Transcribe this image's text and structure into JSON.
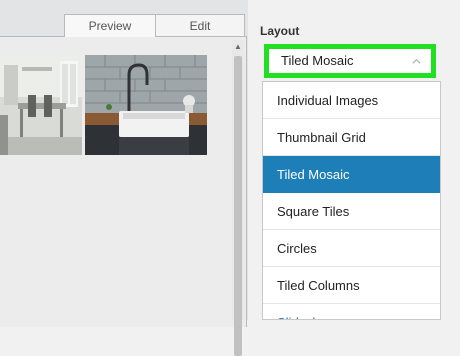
{
  "editor": {
    "tabs": [
      {
        "label": "Preview",
        "active": true
      },
      {
        "label": "Edit",
        "active": false
      }
    ]
  },
  "layout_panel": {
    "heading": "Layout",
    "select": {
      "value": "Tiled Mosaic",
      "icon": "chevron-up-icon"
    },
    "highlight_color": "#21e021",
    "selected_color": "#1e7fb8",
    "options": [
      {
        "label": "Individual Images",
        "selected": false
      },
      {
        "label": "Thumbnail Grid",
        "selected": false
      },
      {
        "label": "Tiled Mosaic",
        "selected": true
      },
      {
        "label": "Square Tiles",
        "selected": false
      },
      {
        "label": "Circles",
        "selected": false
      },
      {
        "label": "Tiled Columns",
        "selected": false
      },
      {
        "label": "Slideshow",
        "selected": false
      }
    ]
  }
}
